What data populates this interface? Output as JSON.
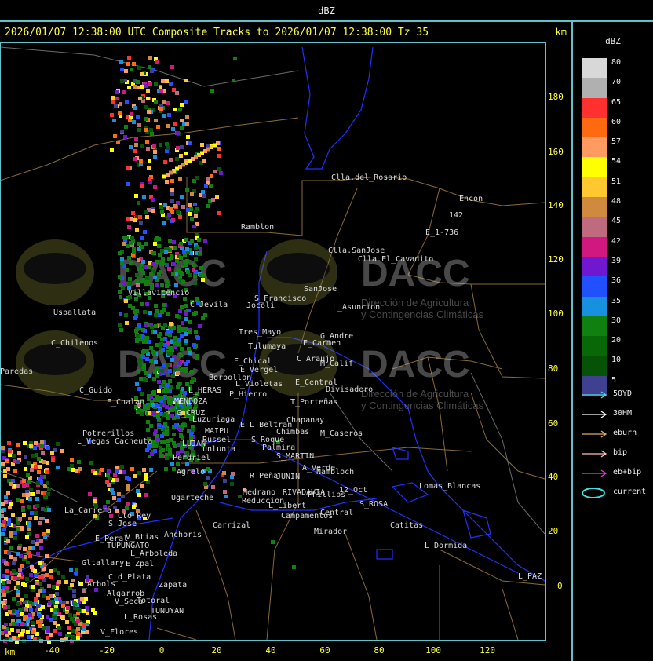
{
  "window_title": "dBZ",
  "header": {
    "title": "2026/01/07 12:38:00 UTC Composite Tracks to 2026/01/07 12:38:00 Tz 35",
    "unit": "km"
  },
  "axes": {
    "x_unit": "km",
    "x_ticks": [
      "-40",
      "-20",
      "0",
      "20",
      "40",
      "60",
      "80",
      "100",
      "120"
    ],
    "y_ticks": [
      "180",
      "160",
      "140",
      "120",
      "100",
      "80",
      "60",
      "40",
      "20",
      "0"
    ]
  },
  "legend": {
    "title": "dBZ",
    "levels": [
      {
        "label": "80",
        "color": "#d8d8d8"
      },
      {
        "label": "70",
        "color": "#b0b0b0"
      },
      {
        "label": "65",
        "color": "#ff3030"
      },
      {
        "label": "60",
        "color": "#ff6a10"
      },
      {
        "label": "57",
        "color": "#ff9a60"
      },
      {
        "label": "54",
        "color": "#ffff00"
      },
      {
        "label": "51",
        "color": "#ffc830"
      },
      {
        "label": "48",
        "color": "#d08a40"
      },
      {
        "label": "45",
        "color": "#c06a80"
      },
      {
        "label": "42",
        "color": "#d01880"
      },
      {
        "label": "39",
        "color": "#7018d0"
      },
      {
        "label": "36",
        "color": "#2050ff"
      },
      {
        "label": "35",
        "color": "#1890e0"
      },
      {
        "label": "30",
        "color": "#108010"
      },
      {
        "label": "20",
        "color": "#086808"
      },
      {
        "label": "10",
        "color": "#065206"
      },
      {
        "label": "5",
        "color": "#404090"
      }
    ]
  },
  "tracks": [
    {
      "label": "50YD",
      "color": "#40e0e0"
    },
    {
      "label": "30HM",
      "color": "#ffffff"
    },
    {
      "label": "eburn",
      "color": "#e0b060"
    },
    {
      "label": "bip",
      "color": "#ffc0c0"
    },
    {
      "label": "eb+bip",
      "color": "#e040e0"
    },
    {
      "label": "current",
      "color": "#40e0e0"
    }
  ],
  "watermark": {
    "brand": "DACC",
    "line1": "Dirección de Agricultura",
    "line2": "y Contingencias Climáticas"
  },
  "places": [
    {
      "name": "Clla.del_Rosario",
      "x": 422,
      "y": 229
    },
    {
      "name": "Encon",
      "x": 585,
      "y": 256
    },
    {
      "name": "142",
      "x": 572,
      "y": 277
    },
    {
      "name": "E_1-736",
      "x": 542,
      "y": 299
    },
    {
      "name": "Ramblon",
      "x": 307,
      "y": 292
    },
    {
      "name": "Clla.SanJose",
      "x": 418,
      "y": 322
    },
    {
      "name": "Clla.El_Cavadito",
      "x": 456,
      "y": 333
    },
    {
      "name": "SanJose",
      "x": 387,
      "y": 371
    },
    {
      "name": "S_Francisco",
      "x": 324,
      "y": 383
    },
    {
      "name": "L_Asuncion",
      "x": 424,
      "y": 394
    },
    {
      "name": "Jocoli",
      "x": 314,
      "y": 392
    },
    {
      "name": "Villavicencio",
      "x": 163,
      "y": 376
    },
    {
      "name": "C_Jevila",
      "x": 242,
      "y": 391
    },
    {
      "name": "Uspallata",
      "x": 68,
      "y": 401
    },
    {
      "name": "Tres_Mayo",
      "x": 304,
      "y": 426
    },
    {
      "name": "G_Andre",
      "x": 408,
      "y": 431
    },
    {
      "name": "E_Carmen",
      "x": 386,
      "y": 440
    },
    {
      "name": "Tulumaya",
      "x": 316,
      "y": 444
    },
    {
      "name": "C_Chilenos",
      "x": 65,
      "y": 440
    },
    {
      "name": "E_Chical",
      "x": 298,
      "y": 463
    },
    {
      "name": "C_Araujo",
      "x": 378,
      "y": 460
    },
    {
      "name": "M_Calif",
      "x": 408,
      "y": 466
    },
    {
      "name": "E_Vergel",
      "x": 306,
      "y": 474
    },
    {
      "name": "Paredas",
      "x": 0,
      "y": 476
    },
    {
      "name": "Borbollon",
      "x": 266,
      "y": 484
    },
    {
      "name": "L_Violetas",
      "x": 300,
      "y": 492
    },
    {
      "name": "E_Central",
      "x": 376,
      "y": 490
    },
    {
      "name": "Divisadero",
      "x": 415,
      "y": 499
    },
    {
      "name": "L_HERAS",
      "x": 240,
      "y": 500
    },
    {
      "name": "P_Hierro",
      "x": 292,
      "y": 505
    },
    {
      "name": "C_Guido",
      "x": 101,
      "y": 500
    },
    {
      "name": "E_Chalao",
      "x": 136,
      "y": 515
    },
    {
      "name": "MENDOZA",
      "x": 222,
      "y": 514
    },
    {
      "name": "T_Porteñas",
      "x": 370,
      "y": 515
    },
    {
      "name": "G_CRUZ",
      "x": 225,
      "y": 529
    },
    {
      "name": "Luzuriaga",
      "x": 245,
      "y": 537
    },
    {
      "name": "Chapanay",
      "x": 365,
      "y": 538
    },
    {
      "name": "E_L_Beltran",
      "x": 306,
      "y": 544
    },
    {
      "name": "MAIPU",
      "x": 261,
      "y": 552
    },
    {
      "name": "Chimbas",
      "x": 352,
      "y": 553
    },
    {
      "name": "M_Caseros",
      "x": 408,
      "y": 555
    },
    {
      "name": "Potrerillos",
      "x": 105,
      "y": 555
    },
    {
      "name": "Russel",
      "x": 258,
      "y": 563
    },
    {
      "name": "S_Roque",
      "x": 320,
      "y": 563
    },
    {
      "name": "L_Vegas",
      "x": 98,
      "y": 565
    },
    {
      "name": "Cacheuta",
      "x": 146,
      "y": 565
    },
    {
      "name": "LUJAN",
      "x": 232,
      "y": 568
    },
    {
      "name": "Palmira",
      "x": 334,
      "y": 573
    },
    {
      "name": "Lunlunta",
      "x": 252,
      "y": 575
    },
    {
      "name": "S_MARTIN",
      "x": 352,
      "y": 584
    },
    {
      "name": "Perdriel",
      "x": 220,
      "y": 586
    },
    {
      "name": "A_Verde",
      "x": 385,
      "y": 599
    },
    {
      "name": "Ñambloch",
      "x": 403,
      "y": 604
    },
    {
      "name": "Agrelo",
      "x": 225,
      "y": 604
    },
    {
      "name": "R_Peña",
      "x": 318,
      "y": 609
    },
    {
      "name": "JUNIN",
      "x": 352,
      "y": 610
    },
    {
      "name": "Lomas_Blancas",
      "x": 534,
      "y": 622
    },
    {
      "name": "12_Oct",
      "x": 432,
      "y": 627
    },
    {
      "name": "Medrano",
      "x": 309,
      "y": 630
    },
    {
      "name": "RIVADAVIA",
      "x": 360,
      "y": 630
    },
    {
      "name": "Phillips",
      "x": 392,
      "y": 633
    },
    {
      "name": "Ugarteche",
      "x": 218,
      "y": 637
    },
    {
      "name": "Reduccion",
      "x": 308,
      "y": 641
    },
    {
      "name": "S_ROSA",
      "x": 458,
      "y": 645
    },
    {
      "name": "L_Libert",
      "x": 342,
      "y": 647
    },
    {
      "name": "La_Carrera",
      "x": 82,
      "y": 653
    },
    {
      "name": "Central",
      "x": 408,
      "y": 656
    },
    {
      "name": "Campamentos",
      "x": 358,
      "y": 660
    },
    {
      "name": "Cto_Rey",
      "x": 150,
      "y": 660
    },
    {
      "name": "S_Jose",
      "x": 138,
      "y": 670
    },
    {
      "name": "Carrizal",
      "x": 271,
      "y": 672
    },
    {
      "name": "Catitas",
      "x": 497,
      "y": 672
    },
    {
      "name": "Anchoris",
      "x": 209,
      "y": 684
    },
    {
      "name": "V_Btias",
      "x": 160,
      "y": 687
    },
    {
      "name": "Mirador",
      "x": 400,
      "y": 680
    },
    {
      "name": "E_Peral",
      "x": 121,
      "y": 689
    },
    {
      "name": "TUPUNGATO",
      "x": 136,
      "y": 698
    },
    {
      "name": "L_Dormida",
      "x": 541,
      "y": 698
    },
    {
      "name": "L_Arboleda",
      "x": 166,
      "y": 708
    },
    {
      "name": "Gltallary",
      "x": 104,
      "y": 720
    },
    {
      "name": "E_Zpal",
      "x": 160,
      "y": 721
    },
    {
      "name": "C_d_Plata",
      "x": 138,
      "y": 738
    },
    {
      "name": "L_PAZ",
      "x": 660,
      "y": 737
    },
    {
      "name": "L_Arbols",
      "x": 99,
      "y": 747
    },
    {
      "name": "Zapata",
      "x": 202,
      "y": 748
    },
    {
      "name": "Algarrob",
      "x": 136,
      "y": 759
    },
    {
      "name": "V_Seca",
      "x": 146,
      "y": 769
    },
    {
      "name": "Totoral",
      "x": 174,
      "y": 768
    },
    {
      "name": "TUNUYAN",
      "x": 192,
      "y": 781
    },
    {
      "name": "L_Rosas",
      "x": 158,
      "y": 789
    },
    {
      "name": "V_Flores",
      "x": 128,
      "y": 808
    }
  ]
}
